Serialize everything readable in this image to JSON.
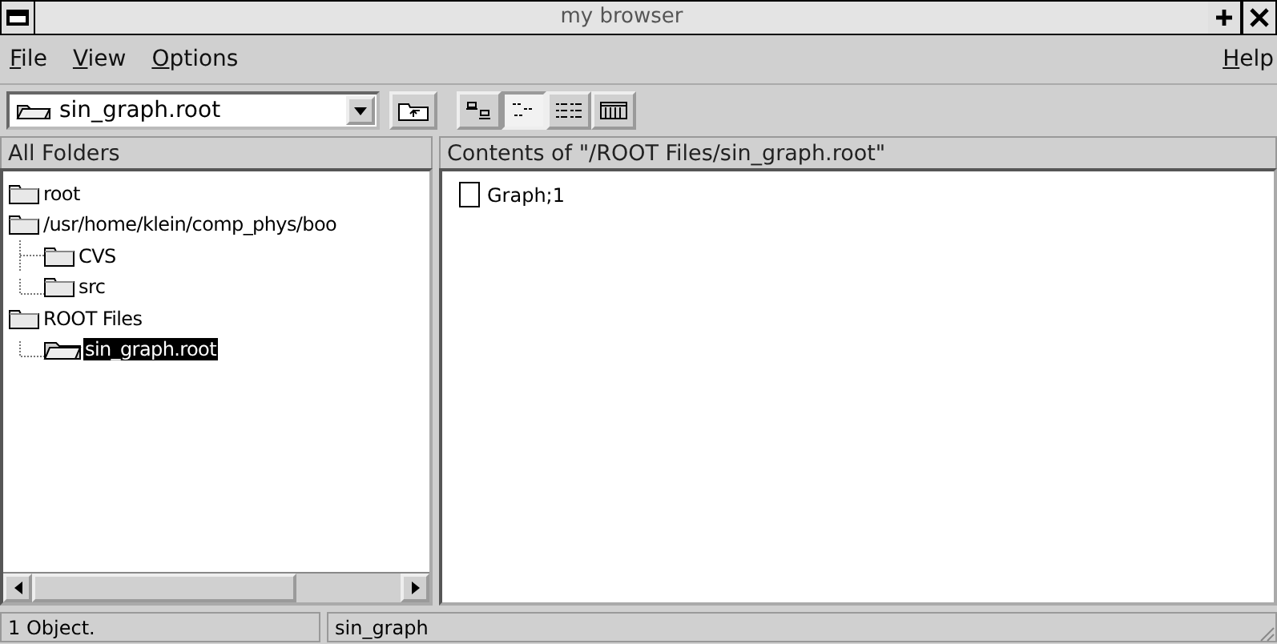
{
  "window": {
    "title": "my browser"
  },
  "menu": [
    {
      "label": "File"
    },
    {
      "label": "View"
    },
    {
      "label": "Options"
    }
  ],
  "help_menu": {
    "label": "Help"
  },
  "location": {
    "value": "sin_graph.root"
  },
  "view_buttons": [
    {
      "kind": "large-icons",
      "selected": false
    },
    {
      "kind": "small-icons",
      "selected": true
    },
    {
      "kind": "list",
      "selected": false
    },
    {
      "kind": "details",
      "selected": false
    }
  ],
  "left_header": "All Folders",
  "right_header": "Contents of \"/ROOT Files/sin_graph.root\"",
  "tree": [
    {
      "label": "root",
      "open": false,
      "selected": false
    },
    {
      "label": "/usr/home/klein/comp_phys/boo",
      "open": false,
      "selected": false,
      "children": [
        {
          "label": "CVS",
          "open": false,
          "selected": false
        },
        {
          "label": "src",
          "open": false,
          "selected": false
        }
      ]
    },
    {
      "label": "ROOT Files",
      "open": false,
      "selected": false,
      "children": [
        {
          "label": "sin_graph.root",
          "open": true,
          "selected": true
        }
      ]
    }
  ],
  "contents": [
    {
      "label": "Graph;1"
    }
  ],
  "status_bar": [
    "1 Object.",
    "sin_graph"
  ]
}
